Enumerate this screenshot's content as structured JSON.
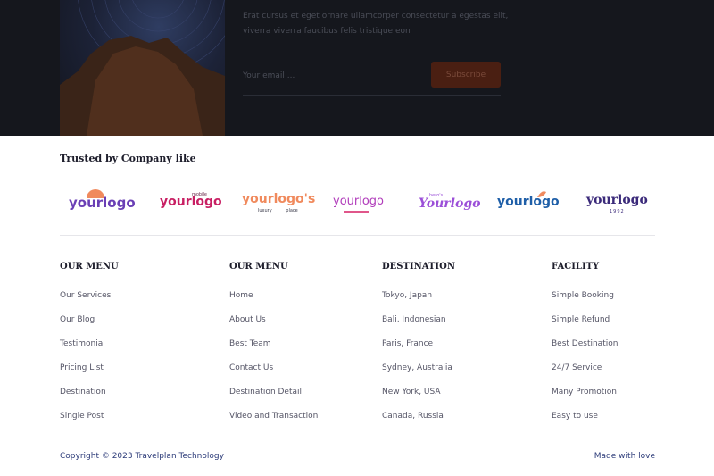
{
  "newsletter": {
    "text": "Erat cursus et eget ornare ullamcorper consectetur a egestas elit, viverra viverra faucibus felis tristique eon",
    "email_placeholder": "Your email ...",
    "subscribe_label": "Subscribe",
    "colors": {
      "background": "#15171d",
      "button": "#4a1f12"
    }
  },
  "trusted": {
    "title": "Trusted by Company like",
    "logos": [
      {
        "word": "yourlogo",
        "extra": "",
        "color": "#6a3fb5",
        "icon": "sun-logo-icon"
      },
      {
        "word": "yourlogo",
        "extra": "mobile",
        "color": "#c81f63",
        "icon": ""
      },
      {
        "word": "yourlogo's",
        "extra": "luxury place",
        "color": "#f08a5d",
        "icon": ""
      },
      {
        "word": "yourlogo",
        "extra": "",
        "color": "#b13dbb",
        "icon": "underline-logo-icon"
      },
      {
        "word": "Yourlogo",
        "extra": "hero's",
        "color": "#9b4fd8",
        "icon": ""
      },
      {
        "word": "yourlogo",
        "extra": "",
        "color": "#1f5fa8",
        "icon": "leaf-logo-icon"
      },
      {
        "word": "yourlogo",
        "extra": "1992",
        "color": "#3b2a7a",
        "icon": ""
      }
    ]
  },
  "footer": {
    "columns": [
      {
        "title": "OUR MENU",
        "items": [
          "Our Services",
          "Our Blog",
          "Testimonial",
          "Pricing List",
          "Destination",
          "Single Post"
        ]
      },
      {
        "title": "OUR MENU",
        "items": [
          "Home",
          "About Us",
          "Best Team",
          "Contact Us",
          "Destination Detail",
          "Video and Transaction"
        ]
      },
      {
        "title": "DESTINATION",
        "items": [
          "Tokyo, Japan",
          "Bali, Indonesian",
          "Paris, France",
          "Sydney, Australia",
          "New York, USA",
          "Canada, Russia"
        ]
      },
      {
        "title": "FACILITY",
        "items": [
          "Simple Booking",
          "Simple Refund",
          "Best Destination",
          "24/7 Service",
          "Many Promotion",
          "Easy to use"
        ]
      }
    ],
    "copyright": "Copyright © 2023 Travelplan Technology",
    "made_with": "Made with love"
  }
}
